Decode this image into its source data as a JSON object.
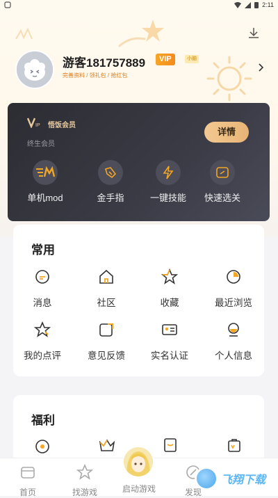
{
  "status_bar": {
    "time": "2:11"
  },
  "profile": {
    "username": "游客181757889",
    "vip_badge": "VIP",
    "vip_sub_badge": "小脑",
    "links": "完善资料 / 领礼包 / 抢红包"
  },
  "vip_card": {
    "title": "悟饭会员",
    "desc": "终生会员",
    "detail_label": "详情",
    "features": [
      {
        "label": "单机mod",
        "icon": "mod-icon"
      },
      {
        "label": "金手指",
        "icon": "cheat-icon"
      },
      {
        "label": "一键技能",
        "icon": "lightning-icon"
      },
      {
        "label": "快速选关",
        "icon": "level-select-icon"
      }
    ]
  },
  "common": {
    "title": "常用",
    "items": [
      {
        "label": "消息",
        "icon": "message-icon"
      },
      {
        "label": "社区",
        "icon": "home-icon"
      },
      {
        "label": "收藏",
        "icon": "star-icon"
      },
      {
        "label": "最近浏览",
        "icon": "history-icon"
      },
      {
        "label": "我的点评",
        "icon": "review-icon"
      },
      {
        "label": "意见反馈",
        "icon": "feedback-icon"
      },
      {
        "label": "实名认证",
        "icon": "id-card-icon"
      },
      {
        "label": "个人信息",
        "icon": "person-icon"
      }
    ]
  },
  "welfare": {
    "title": "福利"
  },
  "tabbar": {
    "tabs": [
      {
        "label": "首页",
        "icon": "home-tab-icon"
      },
      {
        "label": "找游戏",
        "icon": "star-tab-icon"
      },
      {
        "label": "启动游戏",
        "icon": "launch-avatar"
      },
      {
        "label": "发现",
        "icon": "discover-icon"
      }
    ]
  },
  "watermark": {
    "text": "飞翔下载"
  },
  "colors": {
    "accent": "#f5a623",
    "vip_dark": "#2c2d33",
    "gold": "#e8b476"
  }
}
